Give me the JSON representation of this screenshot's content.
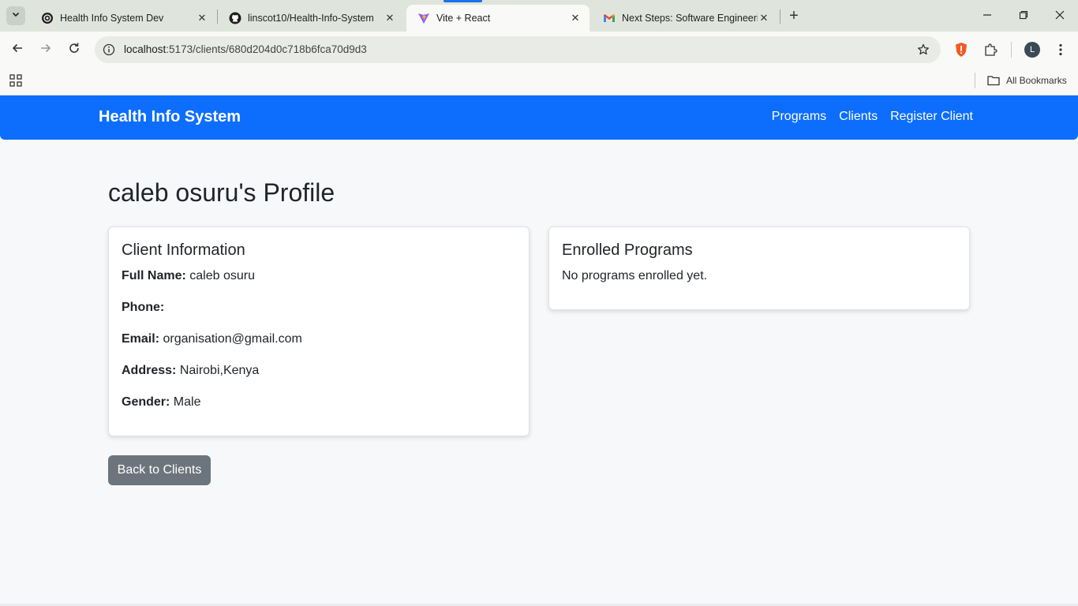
{
  "browser": {
    "tabs": [
      {
        "title": "Health Info System Dev",
        "favicon": "openai-icon",
        "active": false
      },
      {
        "title": "linscot10/Health-Info-System",
        "favicon": "github-icon",
        "active": false
      },
      {
        "title": "Vite + React",
        "favicon": "vite-icon",
        "active": true
      },
      {
        "title": "Next Steps: Software Engineering",
        "favicon": "gmail-icon",
        "active": false
      }
    ],
    "url_host": "localhost",
    "url_path": ":5173/clients/680d204d0c718b6fca70d9d3",
    "bookmarks_label": "All Bookmarks",
    "profile_initial": "L",
    "colors": {
      "tabstrip": "#dfe5dc",
      "toolbar": "#f9f9f7",
      "omnibox": "#e9ebe7"
    }
  },
  "app": {
    "brand": "Health Info System",
    "nav": [
      "Programs",
      "Clients",
      "Register Client"
    ],
    "colors": {
      "primary": "#0d6efd",
      "secondary": "#6c757d",
      "text": "#212529",
      "background": "#f7f8fa"
    }
  },
  "profile": {
    "title": "caleb osuru's Profile",
    "client_card": {
      "heading": "Client Information",
      "fields": [
        {
          "label": "Full Name:",
          "value": "caleb osuru"
        },
        {
          "label": "Phone:",
          "value": ""
        },
        {
          "label": "Email:",
          "value": "organisation@gmail.com"
        },
        {
          "label": "Address:",
          "value": "Nairobi,Kenya"
        },
        {
          "label": "Gender:",
          "value": "Male"
        }
      ]
    },
    "programs_card": {
      "heading": "Enrolled Programs",
      "empty_message": "No programs enrolled yet."
    },
    "back_button": "Back to Clients"
  }
}
